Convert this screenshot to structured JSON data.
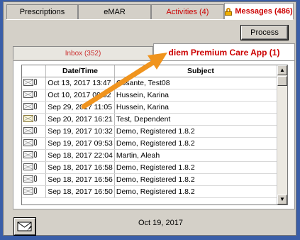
{
  "tabs": [
    {
      "label": "Prescriptions"
    },
    {
      "label": "eMAR"
    },
    {
      "label": "Activities (4)"
    },
    {
      "label": "Messages (486)"
    }
  ],
  "process_label": "Process",
  "inner_tabs": {
    "inbox": "Inbox (352)",
    "app": "diem Premium Care App (1)"
  },
  "table": {
    "headers": [
      "",
      "Date/Time",
      "Subject"
    ],
    "rows": [
      {
        "date": "Oct 13, 2017 13:47",
        "subject": "Cosante, Test08",
        "icon": "envelope-closed-icon"
      },
      {
        "date": "Oct 10, 2017 09:52",
        "subject": "Hussein, Karina",
        "icon": "envelope-closed-icon"
      },
      {
        "date": "Sep 29, 2017 11:05",
        "subject": "Hussein, Karina",
        "icon": "envelope-closed-icon"
      },
      {
        "date": "Sep 20, 2017 16:21",
        "subject": "Test, Dependent",
        "icon": "envelope-open-icon"
      },
      {
        "date": "Sep 19, 2017 10:32",
        "subject": "Demo, Registered 1.8.2",
        "icon": "envelope-closed-icon"
      },
      {
        "date": "Sep 19, 2017 09:53",
        "subject": "Demo, Registered 1.8.2",
        "icon": "envelope-closed-icon"
      },
      {
        "date": "Sep 18, 2017 22:04",
        "subject": "Martin, Aleah",
        "icon": "envelope-closed-icon"
      },
      {
        "date": "Sep 18, 2017 16:58",
        "subject": "Demo, Registered 1.8.2",
        "icon": "envelope-closed-icon"
      },
      {
        "date": "Sep 18, 2017 16:56",
        "subject": "Demo, Registered 1.8.2",
        "icon": "envelope-closed-icon"
      },
      {
        "date": "Sep 18, 2017 16:50",
        "subject": "Demo, Registered 1.8.2",
        "icon": "envelope-closed-icon"
      }
    ]
  },
  "footer_date": "Oct 19, 2017",
  "colors": {
    "accent_red": "#cc0000",
    "arrow_orange": "#f0941e",
    "panel_gray": "#d4d0c8",
    "desktop_blue": "#3a5ea8"
  }
}
